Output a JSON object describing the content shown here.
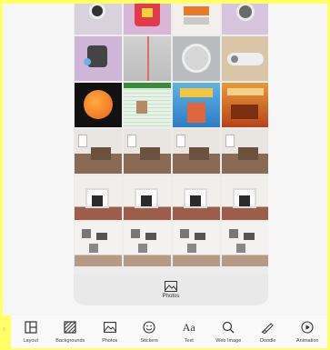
{
  "panel": {
    "footer_label": "Photos"
  },
  "tiles": [
    {
      "id": "r0c0",
      "style": "camera"
    },
    {
      "id": "r0c1",
      "style": "pink-shirt"
    },
    {
      "id": "r0c2",
      "style": "orange-box"
    },
    {
      "id": "r0c3",
      "style": "robot-purple"
    },
    {
      "id": "r1c0",
      "style": "robot-purple2"
    },
    {
      "id": "r1c1",
      "style": "gray-sky",
      "selected": true
    },
    {
      "id": "r1c2",
      "style": "circle-logo",
      "selected": true
    },
    {
      "id": "r1c3",
      "style": "tan-device",
      "selected": true
    },
    {
      "id": "r2c0",
      "style": "orange-ball"
    },
    {
      "id": "r2c1",
      "style": "spreadsheet"
    },
    {
      "id": "r2c2",
      "style": "book-cover"
    },
    {
      "id": "r2c3",
      "style": "book-cover2"
    },
    {
      "id": "r3c0",
      "style": "room"
    },
    {
      "id": "r3c1",
      "style": "room"
    },
    {
      "id": "r3c2",
      "style": "room"
    },
    {
      "id": "r3c3",
      "style": "room"
    },
    {
      "id": "r4c0",
      "style": "fireplace"
    },
    {
      "id": "r4c1",
      "style": "fireplace"
    },
    {
      "id": "r4c2",
      "style": "fireplace"
    },
    {
      "id": "r4c3",
      "style": "fireplace"
    },
    {
      "id": "r5c0",
      "style": "wall"
    },
    {
      "id": "r5c1",
      "style": "wall"
    },
    {
      "id": "r5c2",
      "style": "wall"
    },
    {
      "id": "r5c3",
      "style": "wall"
    }
  ],
  "toolbar": {
    "items": [
      {
        "name": "layout",
        "label": "Layout",
        "icon": "layout-icon"
      },
      {
        "name": "backgrounds",
        "label": "Backgrounds",
        "icon": "backgrounds-icon"
      },
      {
        "name": "photos",
        "label": "Photos",
        "icon": "photo-icon"
      },
      {
        "name": "stickers",
        "label": "Stickers",
        "icon": "smiley-icon"
      },
      {
        "name": "text",
        "label": "Text",
        "icon": "text-icon"
      },
      {
        "name": "web-image",
        "label": "Web Image",
        "icon": "search-icon"
      },
      {
        "name": "doodle",
        "label": "Doodle",
        "icon": "pen-icon"
      },
      {
        "name": "animation",
        "label": "Animation",
        "icon": "play-icon"
      }
    ]
  },
  "colors": {
    "background": "#ffff66",
    "selected_outline": "#5ad2d6"
  }
}
